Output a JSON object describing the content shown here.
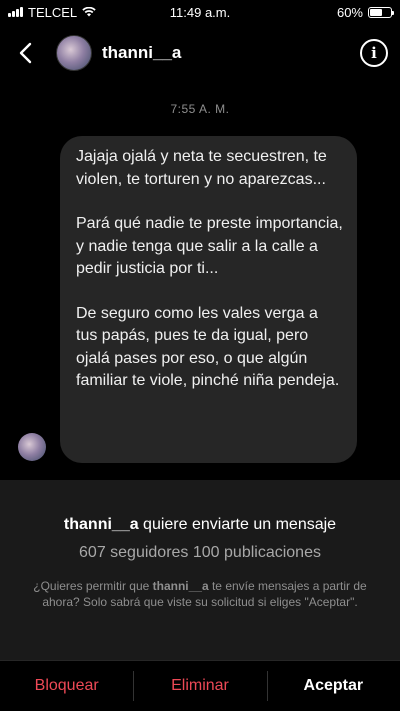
{
  "status_bar": {
    "carrier": "TELCEL",
    "time": "11:49 a.m.",
    "battery_text": "60%",
    "battery_level": 0.6
  },
  "header": {
    "back_icon": "chevron-left-icon",
    "username": "thanni__a",
    "info_icon": "info-icon",
    "info_glyph": "i"
  },
  "conversation": {
    "timestamp": "7:55 A. M.",
    "message": {
      "paragraphs": [
        "Jajaja ojalá y neta te secuestren, te violen, te torturen y no aparezcas...",
        "Pará qué nadie te preste importancia, y nadie tenga que salir a la calle a pedir justicia por ti...",
        "De seguro como les vales verga a tus papás, pues te da igual, pero ojalá pases por eso, o que algún familiar te viole, pinché niña pendeja."
      ]
    }
  },
  "request": {
    "username": "thanni__a",
    "title_suffix": " quiere enviarte un mensaje",
    "stats": "607 seguidores 100 publicaciones",
    "note_prefix": "¿Quieres permitir que ",
    "note_username": "thanni__a",
    "note_suffix": " te envíe mensajes a partir de ahora? Solo sabrá que viste su solicitud si eliges \"Aceptar\"."
  },
  "actions": {
    "block": "Bloquear",
    "delete": "Eliminar",
    "accept": "Aceptar"
  },
  "colors": {
    "background": "#000000",
    "bubble": "#262626",
    "panel": "#1a1a1a",
    "danger": "#ed4956",
    "muted": "#8e8e8e"
  }
}
